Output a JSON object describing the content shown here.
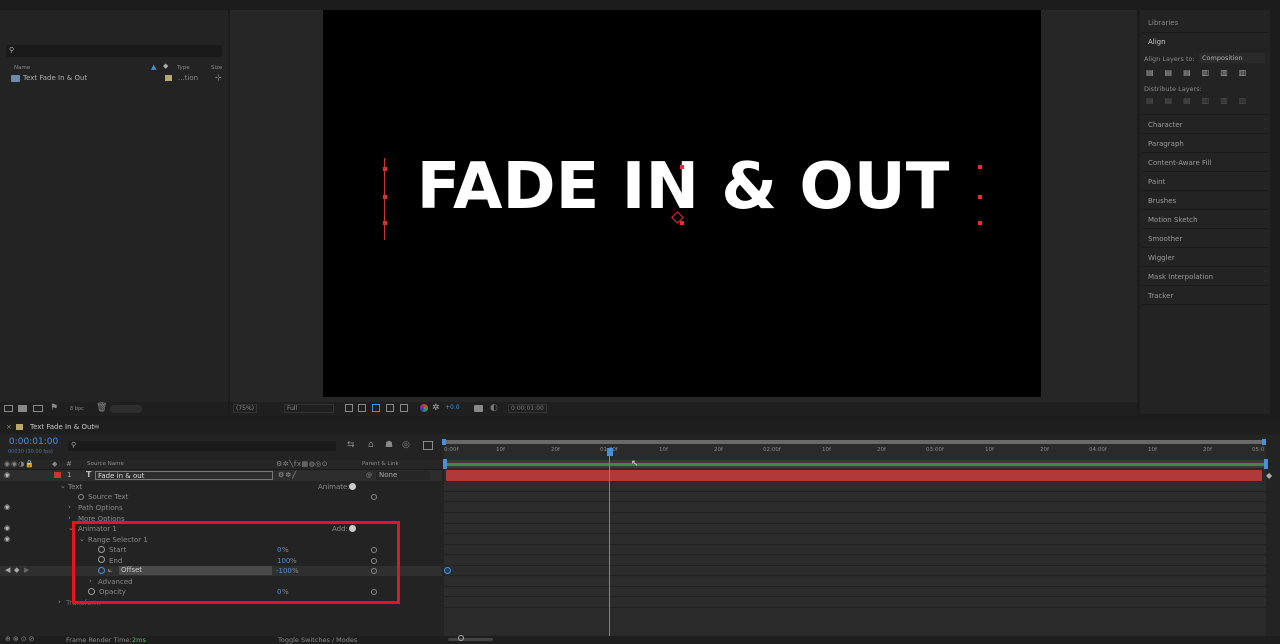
{
  "project": {
    "search_placeholder": "",
    "columns": {
      "name": "Name",
      "type": "Type",
      "size": "Size"
    },
    "items": [
      {
        "name": "Text Fade In & Out",
        "type": "...tion"
      }
    ],
    "bpc": "8 bpc"
  },
  "composition": {
    "text": "FADE IN & OUT",
    "zoom": "(75%)",
    "resolution": "Full",
    "exposure": "+0.0",
    "timecode": "0:00:01:00"
  },
  "right_panel": {
    "libraries": "Libraries",
    "align": "Align",
    "align_layers_to_label": "Align Layers to:",
    "align_layers_to_value": "Composition",
    "distribute_layers": "Distribute Layers:",
    "items": [
      "Character",
      "Paragraph",
      "Content-Aware Fill",
      "Paint",
      "Brushes",
      "Motion Sketch",
      "Smoother",
      "Wiggler",
      "Mask Interpolation",
      "Tracker"
    ]
  },
  "timeline": {
    "tab": "Text Fade In & Out",
    "current_time": "0:00:01:00",
    "frame_info": "00030 (30.00 fps)",
    "columns": {
      "source_name": "Source Name",
      "parent_link": "Parent & Link"
    },
    "layer": {
      "number": "1",
      "name": "Fade in & out",
      "parent": "None"
    },
    "rows": {
      "text": "Text",
      "animate": "Animate:",
      "source_text": "Source Text",
      "path_options": "Path Options",
      "more_options": "More Options",
      "animator1": "Animator 1",
      "add": "Add:",
      "range_selector1": "Range Selector 1",
      "start": "Start",
      "start_value": "0",
      "end": "End",
      "end_value": "100",
      "offset": "Offset",
      "offset_value": "-100",
      "percent": "%",
      "advanced": "Advanced",
      "opacity": "Opacity",
      "opacity_value": "0",
      "transform": "Transform"
    },
    "ruler": [
      "0:00f",
      "10f",
      "20f",
      "01:00f",
      "10f",
      "20f",
      "02:00f",
      "10f",
      "20f",
      "03:00f",
      "10f",
      "20f",
      "04:00f",
      "10f",
      "20f",
      "05:0"
    ],
    "footer": {
      "render_label": "Frame Render Time:",
      "render_value": "2ms",
      "toggle": "Toggle Switches / Modes"
    }
  },
  "colors": {
    "accent": "#4a8fd8",
    "highlight": "#e3151f",
    "layer_bar": "#b03a3a",
    "work_area": "#4a8fd8"
  }
}
